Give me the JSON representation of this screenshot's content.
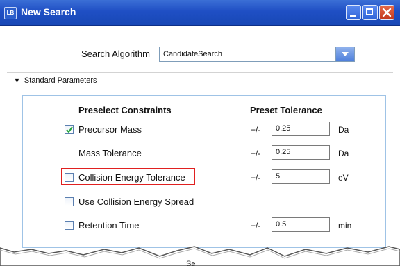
{
  "window": {
    "title": "New Search",
    "app_icon_text": "LB"
  },
  "algorithm": {
    "label": "Search Algorithm",
    "value": "CandidateSearch"
  },
  "section": {
    "toggle": "▼",
    "title": "Standard Parameters"
  },
  "columns": {
    "constraints": "Preselect Constraints",
    "tolerance": "Preset Tolerance"
  },
  "rows": [
    {
      "label": "Precursor Mass",
      "has_checkbox": true,
      "checked": true,
      "pm": "+/-",
      "value": "0.25",
      "unit": "Da"
    },
    {
      "label": "Mass Tolerance",
      "has_checkbox": false,
      "checked": false,
      "pm": "+/-",
      "value": "0.25",
      "unit": "Da"
    },
    {
      "label": "Collision Energy Tolerance",
      "has_checkbox": true,
      "checked": false,
      "pm": "+/-",
      "value": "5",
      "unit": "eV"
    },
    {
      "label": "Use Collision Energy Spread",
      "has_checkbox": true,
      "checked": false
    },
    {
      "label": "Retention Time",
      "has_checkbox": true,
      "checked": false,
      "pm": "+/-",
      "value": "0.5",
      "unit": "min"
    }
  ],
  "footer": {
    "partial_text": "Se"
  },
  "colors": {
    "titlebar": "#1f4fc4",
    "highlight": "#e02020",
    "group_border": "#9fc3e6"
  }
}
